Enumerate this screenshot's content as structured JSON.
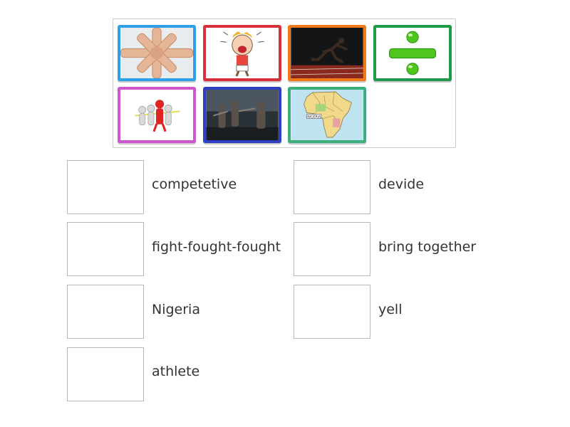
{
  "tiles": [
    {
      "icon": "hands-together-icon",
      "border_color": "#2f9fe8"
    },
    {
      "icon": "yelling-boy-icon",
      "border_color": "#d7303b"
    },
    {
      "icon": "sprinter-athlete-icon",
      "border_color": "#f07a1a"
    },
    {
      "icon": "divide-sign-icon",
      "border_color": "#1f9a4a"
    },
    {
      "icon": "race-leader-figures-icon",
      "border_color": "#cf55cf"
    },
    {
      "icon": "soldiers-fighting-icon",
      "border_color": "#2d3fc2"
    },
    {
      "icon": "africa-map-icon",
      "border_color": "#3cae7a",
      "map_label": "NIGERIA"
    }
  ],
  "words": [
    "competetive",
    "devide",
    "fight-fought-fought",
    "bring together",
    "Nigeria",
    "yell",
    "athlete"
  ]
}
